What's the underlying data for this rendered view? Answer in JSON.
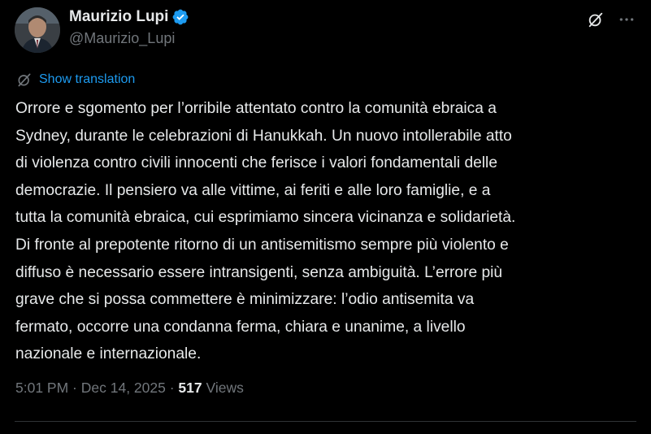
{
  "author": {
    "display_name": "Maurizio Lupi",
    "handle": "@Maurizio_Lupi",
    "verified": true,
    "avatar_icon": "user-avatar"
  },
  "actions": {
    "translate_icon": "translate-icon",
    "more_icon": "more-horizontal-icon"
  },
  "translation": {
    "label": "Show translation"
  },
  "post": {
    "text": "Orrore e sgomento per l’orribile attentato contro la comunità ebraica a\nSydney, durante le celebrazioni di Hanukkah. Un nuovo intollerabile atto\ndi violenza contro civili innocenti che ferisce i valori fondamentali delle\ndemocrazie. Il pensiero va alle vittime, ai feriti e alle loro famiglie, e a\ntutta la comunità ebraica, cui esprimiamo sincera vicinanza e solidarietà.\nDi fronte al prepotente ritorno di un antisemitismo sempre più violento e\ndiffuso è necessario essere intransigenti, senza ambiguità. L’errore più\ngrave che si possa commettere è minimizzare: l’odio antisemita va\nfermato, occorre una condanna ferma, chiara e unanime, a livello\nnazionale e internazionale."
  },
  "meta": {
    "time": "5:01 PM",
    "sep1": " · ",
    "date": "Dec 14, 2025",
    "sep2": " · ",
    "views_count": "517",
    "views_label": " Views"
  },
  "colors": {
    "background": "#000000",
    "text": "#e7e9ea",
    "muted": "#71767b",
    "accent": "#1d9bf0",
    "divider": "#2f3336"
  }
}
